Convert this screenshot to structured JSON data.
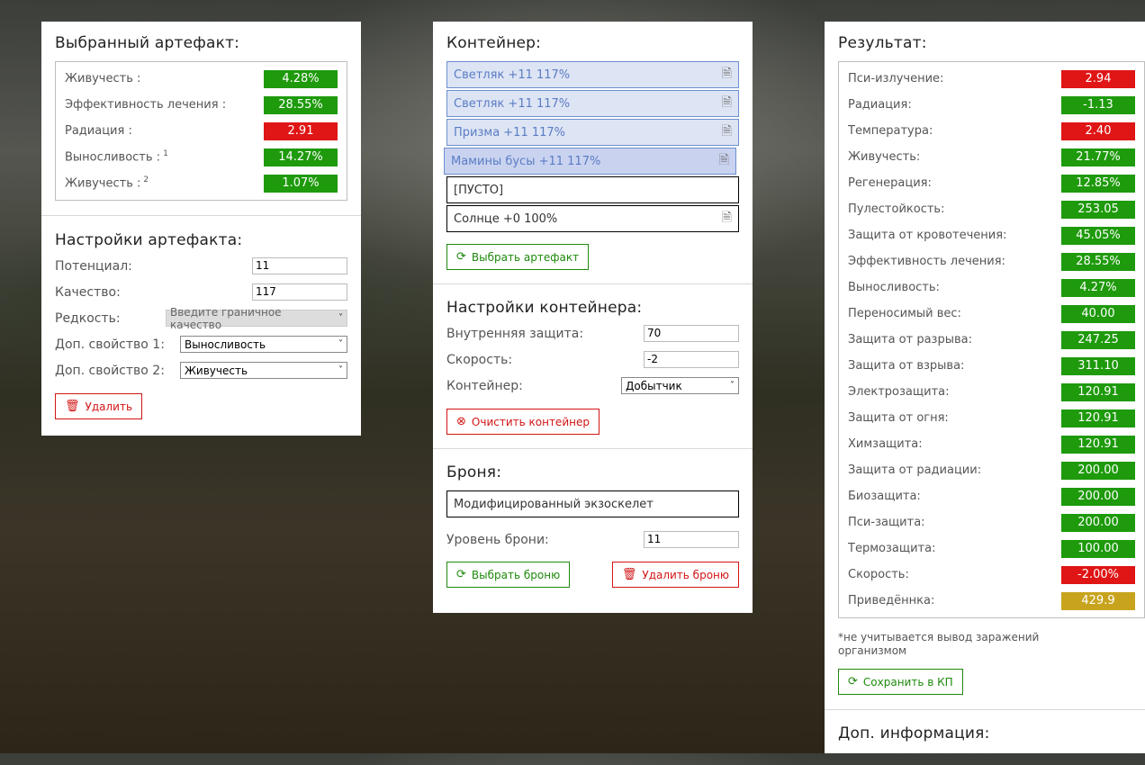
{
  "selected": {
    "title": "Выбранный артефакт:",
    "stats": [
      {
        "label": "Живучесть :",
        "sup": "",
        "value": "4.28%",
        "color": "green"
      },
      {
        "label": "Эффективность лечения :",
        "sup": "",
        "value": "28.55%",
        "color": "green"
      },
      {
        "label": "Радиация :",
        "sup": "",
        "value": "2.91",
        "color": "red"
      },
      {
        "label": "Выносливость :",
        "sup": "1",
        "value": "14.27%",
        "color": "green"
      },
      {
        "label": "Живучесть :",
        "sup": "2",
        "value": "1.07%",
        "color": "green"
      }
    ]
  },
  "artifact_settings": {
    "title": "Настройки артефакта:",
    "potential_label": "Потенциал:",
    "potential_value": "11",
    "quality_label": "Качество:",
    "quality_value": "117",
    "rarity_label": "Редкость:",
    "rarity_value": "Введите граничное качество",
    "prop1_label": "Доп. свойство 1:",
    "prop1_value": "Выносливость",
    "prop2_label": "Доп. свойство 2:",
    "prop2_value": "Живучесть",
    "delete_label": "Удалить"
  },
  "container": {
    "title": "Контейнер:",
    "slots": [
      {
        "text": "Светляк +11 117%"
      },
      {
        "text": "Светляк +11 117%"
      },
      {
        "text": "Призма +11 117%"
      },
      {
        "text": "Мамины бусы +11 117%"
      },
      {
        "text": "[ПУСТО]"
      },
      {
        "text": "Солнце +0 100%"
      }
    ],
    "choose_label": "Выбрать артефакт"
  },
  "container_settings": {
    "title": "Настройки контейнера:",
    "protection_label": "Внутренняя защита:",
    "protection_value": "70",
    "speed_label": "Скорость:",
    "speed_value": "-2",
    "container_label": "Контейнер:",
    "container_value": "Добытчик",
    "clear_label": "Очистить контейнер"
  },
  "armor": {
    "title": "Броня:",
    "name": "Модифицированный экзоскелет",
    "level_label": "Уровень брони:",
    "level_value": "11",
    "choose_label": "Выбрать броню",
    "delete_label": "Удалить броню"
  },
  "result": {
    "title": "Результат:",
    "stats": [
      {
        "label": "Пси-излучение:",
        "value": "2.94",
        "color": "red"
      },
      {
        "label": "Радиация:",
        "value": "-1.13",
        "color": "green"
      },
      {
        "label": "Температура:",
        "value": "2.40",
        "color": "red"
      },
      {
        "label": "Живучесть:",
        "value": "21.77%",
        "color": "green"
      },
      {
        "label": "Регенерация:",
        "value": "12.85%",
        "color": "green"
      },
      {
        "label": "Пулестойкость:",
        "value": "253.05",
        "color": "green"
      },
      {
        "label": "Защита от кровотечения:",
        "value": "45.05%",
        "color": "green"
      },
      {
        "label": "Эффективность лечения:",
        "value": "28.55%",
        "color": "green"
      },
      {
        "label": "Выносливость:",
        "value": "4.27%",
        "color": "green"
      },
      {
        "label": "Переносимый вес:",
        "value": "40.00",
        "color": "green"
      },
      {
        "label": "Защита от разрыва:",
        "value": "247.25",
        "color": "green"
      },
      {
        "label": "Защита от взрыва:",
        "value": "311.10",
        "color": "green"
      },
      {
        "label": "Электрозащита:",
        "value": "120.91",
        "color": "green"
      },
      {
        "label": "Защита от огня:",
        "value": "120.91",
        "color": "green"
      },
      {
        "label": "Химзащита:",
        "value": "120.91",
        "color": "green"
      },
      {
        "label": "Защита от радиации:",
        "value": "200.00",
        "color": "green"
      },
      {
        "label": "Биозащита:",
        "value": "200.00",
        "color": "green"
      },
      {
        "label": "Пси-защита:",
        "value": "200.00",
        "color": "green"
      },
      {
        "label": "Термозащита:",
        "value": "100.00",
        "color": "green"
      },
      {
        "label": "Скорость:",
        "value": "-2.00%",
        "color": "red"
      },
      {
        "label": "Приведённка:",
        "value": "429.9",
        "color": "gold"
      }
    ],
    "note": "*не учитывается вывод заражений организмом",
    "save_label": "Сохранить в КП",
    "extra_title": "Доп. информация:"
  },
  "colors": {
    "green": "#1e9a0c",
    "red": "#e01515",
    "gold": "#c8a41e",
    "slot_blue": "#dde4f4"
  }
}
